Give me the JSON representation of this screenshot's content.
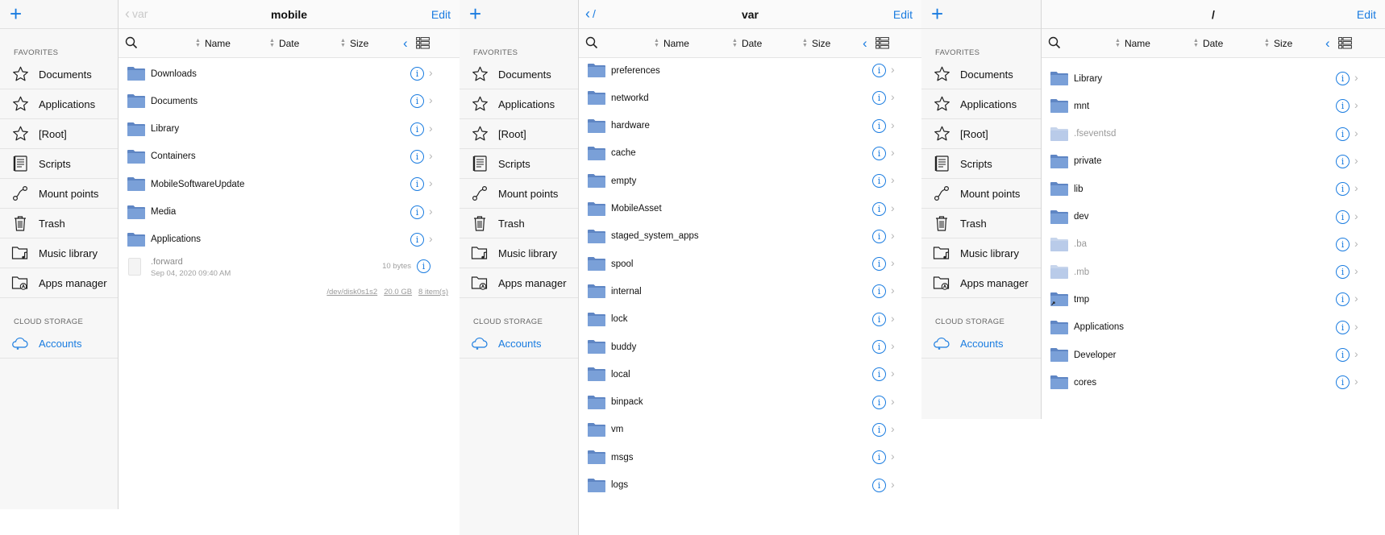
{
  "colors": {
    "accent": "#1a7ce0",
    "folder": "#6f95d1",
    "folder_dim": "#b9cbe9"
  },
  "sidebar": {
    "add_icon": "+",
    "favorites_header": "FAVORITES",
    "items": [
      {
        "label": "Documents",
        "icon": "star-icon"
      },
      {
        "label": "Applications",
        "icon": "star-icon"
      },
      {
        "label": "[Root]",
        "icon": "star-icon"
      },
      {
        "label": "Scripts",
        "icon": "script-icon"
      },
      {
        "label": "Mount points",
        "icon": "mount-icon"
      },
      {
        "label": "Trash",
        "icon": "trash-icon"
      },
      {
        "label": "Music library",
        "icon": "music-folder-icon"
      },
      {
        "label": "Apps manager",
        "icon": "apps-folder-icon"
      }
    ],
    "cloud_header": "CLOUD STORAGE",
    "accounts": "Accounts"
  },
  "toolbar": {
    "name": "Name",
    "date": "Date",
    "size": "Size"
  },
  "screen1": {
    "back": "var",
    "title": "mobile",
    "edit": "Edit",
    "folders": [
      "Downloads",
      "Documents",
      "Library",
      "Containers",
      "MobileSoftwareUpdate",
      "Media",
      "Applications"
    ],
    "file": {
      "name": ".forward",
      "date": "Sep 04, 2020 09:40 AM",
      "size": "10 bytes"
    },
    "footer": {
      "disk": "/dev/disk0s1s2",
      "capacity": "20.0 GB",
      "items": "8 item(s)"
    }
  },
  "screen2": {
    "back": "/",
    "title": "var",
    "edit": "Edit",
    "folders": [
      "preferences",
      "networkd",
      "hardware",
      "cache",
      "empty",
      "MobileAsset",
      "staged_system_apps",
      "spool",
      "internal",
      "lock",
      "buddy",
      "local",
      "binpack",
      "vm",
      "msgs",
      "logs"
    ]
  },
  "screen3": {
    "title": "/",
    "edit": "Edit",
    "folders": [
      {
        "name": "Library",
        "dim": false
      },
      {
        "name": "mnt",
        "dim": false
      },
      {
        "name": ".fseventsd",
        "dim": true
      },
      {
        "name": "private",
        "dim": false
      },
      {
        "name": "lib",
        "dim": false
      },
      {
        "name": "dev",
        "dim": false
      },
      {
        "name": ".ba",
        "dim": true
      },
      {
        "name": ".mb",
        "dim": true
      },
      {
        "name": "tmp",
        "dim": false,
        "alias": true
      },
      {
        "name": "Applications",
        "dim": false
      },
      {
        "name": "Developer",
        "dim": false
      },
      {
        "name": "cores",
        "dim": false
      }
    ]
  }
}
